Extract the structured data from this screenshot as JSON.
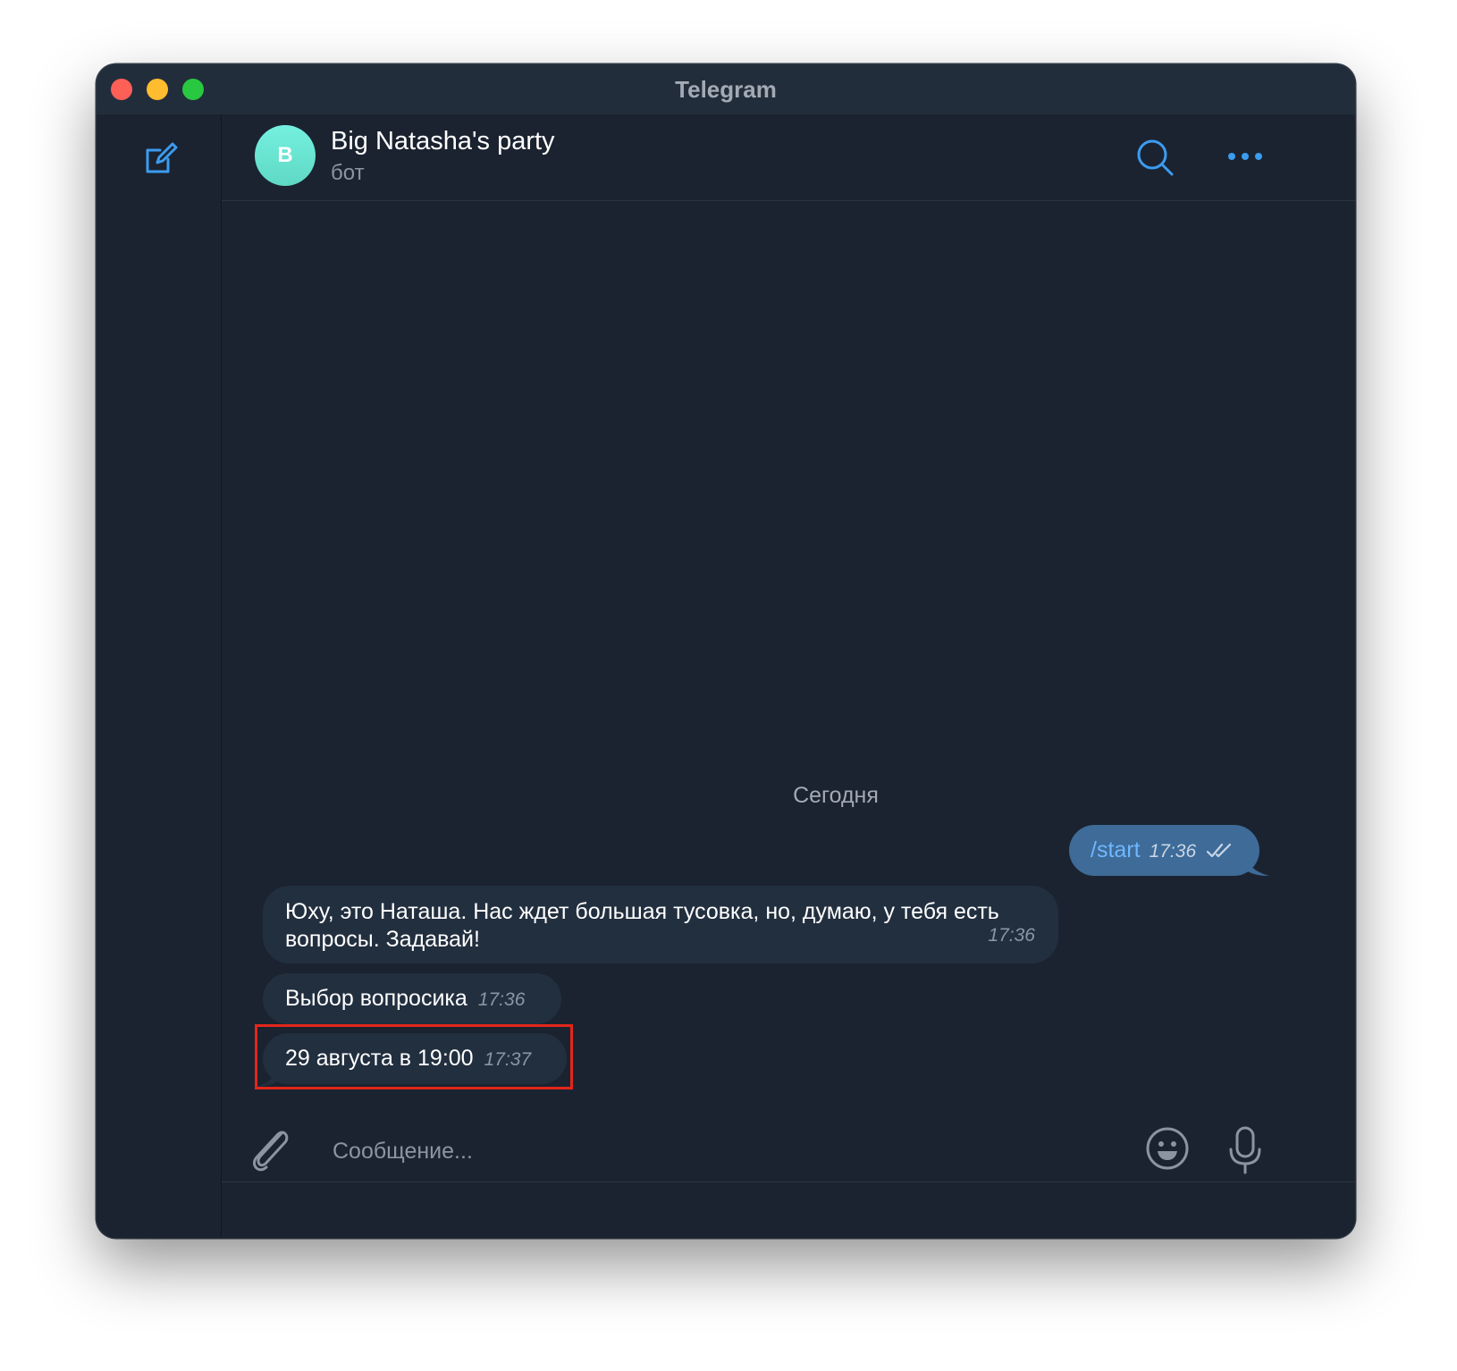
{
  "window": {
    "title": "Telegram"
  },
  "chat": {
    "name": "Big Natasha's party",
    "status": "бот",
    "avatar_letter": "B",
    "avatar_color": "#6ee8d6"
  },
  "messages": {
    "date_separator": "Сегодня",
    "items": [
      {
        "direction": "out",
        "text": "/start",
        "time": "17:36",
        "read": true
      },
      {
        "direction": "in",
        "text": "Юху, это Наташа. Нас ждет большая тусовка, но, думаю, у тебя есть вопросы. Задавай!",
        "time": "17:36"
      },
      {
        "direction": "in",
        "text": "Выбор вопросика",
        "time": "17:36"
      },
      {
        "direction": "in",
        "text": "29 августа в 19:00",
        "time": "17:37",
        "highlighted": true
      }
    ]
  },
  "composer": {
    "placeholder": "Сообщение...",
    "value": ""
  },
  "icons": {
    "compose": "compose-icon",
    "search": "search-icon",
    "more": "more-icon",
    "attach": "paperclip-icon",
    "emoji": "smiley-icon",
    "mic": "microphone-icon",
    "read_receipt": "double-check-icon"
  },
  "colors": {
    "accent": "#3b9cf0",
    "highlight": "#e3261a",
    "outgoing_bubble": "#3e6b98",
    "incoming_bubble": "#222f3f"
  }
}
